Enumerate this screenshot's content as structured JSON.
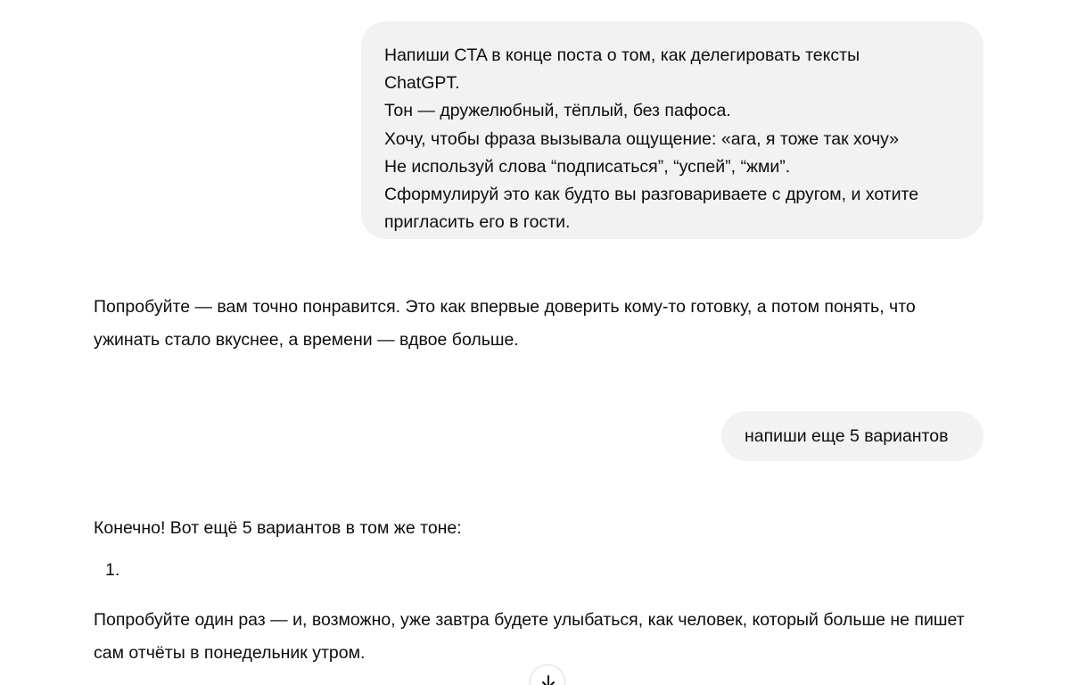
{
  "conversation": {
    "user_message_1": {
      "lines": [
        "Напиши CTA в конце поста о том, как делегировать тексты",
        "ChatGPT.",
        "Тон — дружелюбный, тёплый, без пафоса.",
        "Хочу, чтобы фраза вызывала ощущение: «ага, я тоже так хочу»",
        "Не используй слова “подписаться”, “успей”, “жми”.",
        "Сформулируй это как будто вы разговариваете с другом, и хотите",
        "пригласить его в гости."
      ]
    },
    "assistant_message_1": {
      "text": "Попробуйте — вам точно понравится. Это как впервые доверить кому-то готовку, а потом понять, что ужинать стало вкуснее, а времени — вдвое больше."
    },
    "user_message_2": {
      "text": "напиши еще 5 вариантов"
    },
    "assistant_message_2": {
      "intro": "Конечно! Вот ещё 5 вариантов в том же тоне:",
      "list_number": "1.",
      "item_1": "Попробуйте один раз — и, возможно, уже завтра будете улыбаться, как человек, который больше не пишет сам отчёты в понедельник утром."
    }
  },
  "controls": {
    "scroll_down_icon": "arrow-down-icon"
  },
  "colors": {
    "user_bubble_bg": "#f2f2f2",
    "text": "#0d0d0d",
    "background": "#ffffff"
  }
}
